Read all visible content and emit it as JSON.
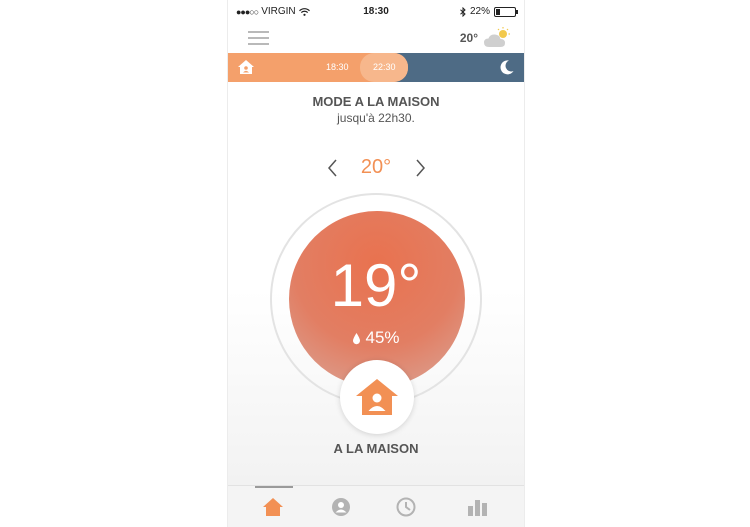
{
  "status": {
    "carrier": "VIRGIN",
    "time": "18:30",
    "battery": "22%",
    "battery_level": 0.22
  },
  "header": {
    "menu_icon": "hamburger-icon",
    "weather_temp": "20°",
    "weather_icon": "partly-cloudy-icon"
  },
  "timeline": {
    "start_time": "18:30",
    "end_time": "22:30",
    "start_icon": "home-icon",
    "end_icon": "moon-icon",
    "colors": {
      "day": "#f4a06b",
      "current": "#f7b78c",
      "night": "#4e6b85"
    }
  },
  "mode": {
    "title": "MODE A LA MAISON",
    "subtitle": "jusqu'à 22h30."
  },
  "setpoint": {
    "value": "20°",
    "decrease_icon": "chevron-left-icon",
    "increase_icon": "chevron-right-icon"
  },
  "dial": {
    "current_temp": "19°",
    "humidity": "45%",
    "humidity_icon": "drop-icon",
    "color": "#e9724f"
  },
  "mode_button": {
    "icon": "home-person-icon",
    "label": "A LA MAISON"
  },
  "tabs": [
    {
      "name": "home",
      "icon": "home-icon",
      "active": true
    },
    {
      "name": "profile",
      "icon": "user-icon",
      "active": false
    },
    {
      "name": "schedule",
      "icon": "clock-icon",
      "active": false
    },
    {
      "name": "stats",
      "icon": "bar-chart-icon",
      "active": false
    }
  ],
  "accent_color": "#f29054"
}
